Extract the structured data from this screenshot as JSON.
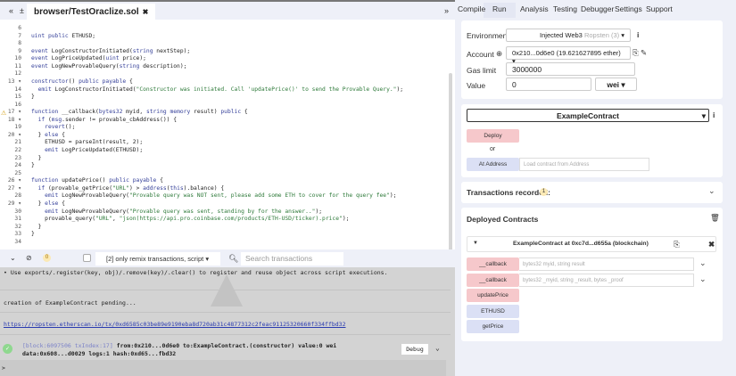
{
  "editor": {
    "file_tab": "browser/TestOraclize.sol",
    "lines": [
      {
        "n": "6",
        "t": ""
      },
      {
        "n": "7",
        "t": "uint public ETHUSD;"
      },
      {
        "n": "8",
        "t": ""
      },
      {
        "n": "9",
        "t": "event LogConstructorInitiated(string nextStep);"
      },
      {
        "n": "10",
        "t": "event LogPriceUpdated(uint price);"
      },
      {
        "n": "11",
        "t": "event LogNewProvableQuery(string description);"
      },
      {
        "n": "12",
        "t": ""
      },
      {
        "n": "13 ▾",
        "t": "constructor() public payable {"
      },
      {
        "n": "14",
        "t": "  emit LogConstructorInitiated(\"Constructor was initiated. Call 'updatePrice()' to send the Provable Query.\");"
      },
      {
        "n": "15",
        "t": "}"
      },
      {
        "n": "16",
        "t": ""
      },
      {
        "n": "17 ▾",
        "t": "function __callback(bytes32 myid, string memory result) public {"
      },
      {
        "n": "18 ▾",
        "t": "  if (msg.sender != provable_cbAddress()) {"
      },
      {
        "n": "19",
        "t": "    revert();"
      },
      {
        "n": "20 ▾",
        "t": "  } else {"
      },
      {
        "n": "21",
        "t": "    ETHUSD = parseInt(result, 2);"
      },
      {
        "n": "22",
        "t": "    emit LogPriceUpdated(ETHUSD);"
      },
      {
        "n": "23",
        "t": "  }"
      },
      {
        "n": "24",
        "t": "}"
      },
      {
        "n": "25",
        "t": ""
      },
      {
        "n": "26 ▾",
        "t": "function updatePrice() public payable {"
      },
      {
        "n": "27 ▾",
        "t": "  if (provable_getPrice(\"URL\") > address(this).balance) {"
      },
      {
        "n": "28",
        "t": "    emit LogNewProvableQuery(\"Provable query was NOT sent, please add some ETH to cover for the query fee\");"
      },
      {
        "n": "29 ▾",
        "t": "  } else {"
      },
      {
        "n": "30",
        "t": "    emit LogNewProvableQuery(\"Provable query was sent, standing by for the answer..\");"
      },
      {
        "n": "31",
        "t": "    provable_query(\"URL\", \"json(https://api.pro.coinbase.com/products/ETH-USD/ticker).price\");"
      },
      {
        "n": "32",
        "t": "  }"
      },
      {
        "n": "33",
        "t": "}"
      },
      {
        "n": "34",
        "t": ""
      }
    ]
  },
  "terminal": {
    "pending_count": "0",
    "filter": "[2] only remix transactions, script",
    "search_placeholder": "Search transactions",
    "hint": "• Use exports/.register(key, obj)/.remove(key)/.clear() to register and reuse object across script executions.",
    "pending": "creation of ExampleContract pending...",
    "link": "https://ropsten.etherscan.io/tx/0xd6585c03be89e9190eba8d720ab31c4877312c2feac91125320660f334ffbd32",
    "tx_block": "[block:6097506 txIndex:17]",
    "tx_line1": " from:0x210...0d6e0 to:ExampleContract.(constructor) value:0 wei",
    "tx_line2": "data:0x608...d0029 logs:1 hash:0xd65...fbd32",
    "debug": "Debug",
    "prompt": ">"
  },
  "right": {
    "tabs": [
      "Compile",
      "Run",
      "Analysis",
      "Testing",
      "Debugger",
      "Settings",
      "Support"
    ],
    "environment_label": "Environment",
    "environment_value": "Injected Web3",
    "environment_network": "Ropsten (3)",
    "account_label": "Account",
    "account_value": "0x210...0d6e0 (19.621627895 ether)",
    "gas_label": "Gas limit",
    "gas_value": "3000000",
    "value_label": "Value",
    "value_value": "0",
    "value_unit": "wei",
    "contract": "ExampleContract",
    "deploy": "Deploy",
    "or": "or",
    "at_address": "At Address",
    "at_address_placeholder": "Load contract from Address",
    "tx_recorded": "Transactions recorded:",
    "tx_count": "1",
    "deployed_title": "Deployed Contracts",
    "instance": "ExampleContract at 0xc7d...d655a (blockchain)",
    "functions": [
      {
        "name": "__callback",
        "params": "bytes32 myid, string result"
      },
      {
        "name": "__callback",
        "params": "bytes32 _myid, string _result, bytes _proof"
      },
      {
        "name": "updatePrice"
      },
      {
        "name": "ETHUSD"
      },
      {
        "name": "getPrice"
      }
    ]
  }
}
